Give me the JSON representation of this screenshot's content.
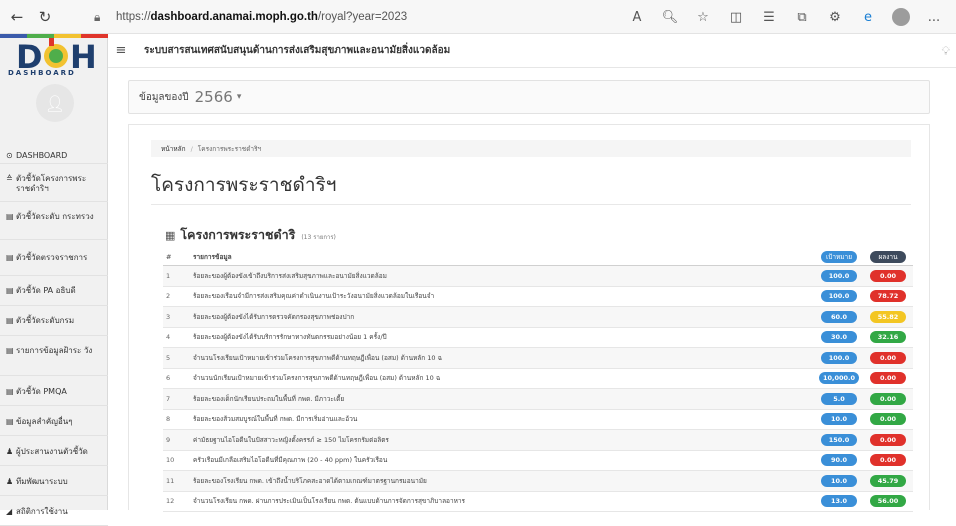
{
  "browser": {
    "back_icon": "back-arrow-icon",
    "reload_icon": "reload-icon",
    "url_scheme": "https://",
    "url_host": "dashboard.anamai.moph.go.th",
    "url_path": "/royal?year=2023",
    "more_label": "..."
  },
  "sidebar": {
    "logo_text": "DASHBOARD",
    "items": [
      {
        "icon": "⊙",
        "label": "DASHBOARD"
      },
      {
        "icon": "≙",
        "label": "ตัวชี้วัดโครงการพระ ราชดำริฯ"
      },
      {
        "icon": "▤",
        "label": "ตัวชี้วัดระดับ กระทรวง"
      },
      {
        "icon": "▤",
        "label": "ตัวชี้วัดตรวจราชการ"
      },
      {
        "icon": "▤",
        "label": "ตัวชี้วัด PA อธิบดี"
      },
      {
        "icon": "▤",
        "label": "ตัวชี้วัดระดับกรม"
      },
      {
        "icon": "▤",
        "label": "รายการข้อมูลฝ้าระ วัง"
      },
      {
        "icon": "▤",
        "label": "ตัวชี้วัด PMQA"
      },
      {
        "icon": "▤",
        "label": "ข้อมูลสำคัญอื่นๆ"
      },
      {
        "icon": "♟",
        "label": "ผู้ประสานงานตัวชี้วัด"
      },
      {
        "icon": "♟",
        "label": "ทีมพัฒนาระบบ"
      },
      {
        "icon": "◢",
        "label": "สถิติการใช้งาน"
      }
    ]
  },
  "topbar": {
    "title": "ระบบสารสนเทศสนับสนุนด้านการส่งเสริมสุขภาพและอนามัยสิ่งแวดล้อม"
  },
  "year_selector": {
    "label": "ข้อมูลของปี",
    "value": "2566"
  },
  "breadcrumb": {
    "home": "หน้าหลัก",
    "separator": "/",
    "current": "โครงการพระราชดำริฯ"
  },
  "page": {
    "title": "โครงการพระราชดำริฯ",
    "section_title": "โครงการพระราชดำริ",
    "section_count": "(13 รายการ)"
  },
  "table": {
    "headers": {
      "no": "#",
      "name": "รายการข้อมูล",
      "target": "เป้าหมาย",
      "result": "ผลงาน"
    },
    "rows": [
      {
        "no": "1",
        "name": "ร้อยละของผู้ต้องขังเข้าถึงบริการส่งเสริมสุขภาพและอนามัยสิ่งแวดล้อม",
        "target": "100.0",
        "result": "0.00",
        "status": "red"
      },
      {
        "no": "2",
        "name": "ร้อยละของเรือนจำมีการส่งเสริมคุณค่าดำเนินงานเป้าระวังอนามัยสิ่งแวดล้อมในเรือนจำ",
        "target": "100.0",
        "result": "78.72",
        "status": "red"
      },
      {
        "no": "3",
        "name": "ร้อยละของผู้ต้องขังได้รับการตรวจคัดกรองสุขภาพช่องปาก",
        "target": "60.0",
        "result": "55.82",
        "status": "yellow"
      },
      {
        "no": "4",
        "name": "ร้อยละของผู้ต้องขังได้รับบริการรักษาทางทันตกรรมอย่างน้อย 1 ครั้ง/ปี",
        "target": "30.0",
        "result": "32.16",
        "status": "green"
      },
      {
        "no": "5",
        "name": "จำนวนโรงเรียนเป้าหมายเข้าร่วมโครงการสุขภาพดีด้านทฤษฎีเพื่อน (อสม) ด้านหลัก 10 ฉ",
        "target": "100.0",
        "result": "0.00",
        "status": "red"
      },
      {
        "no": "6",
        "name": "จำนวนนักเรียนเป้าหมายเข้าร่วมโครงการสุขภาพดีด้านทฤษฎีเพื่อน (อสม) ด้านหลัก 10 ฉ",
        "target": "10,000.0",
        "result": "0.00",
        "status": "red"
      },
      {
        "no": "7",
        "name": "ร้อยละของเด็กนักเรียนประถมในพื้นที่ กพด. มีภาวะเตี้ย",
        "target": "5.0",
        "result": "0.00",
        "status": "green"
      },
      {
        "no": "8",
        "name": "ร้อยละของส้วมสมบูรณ์ในพื้นที่ กพด. มีการเริ่มอ่านและอ้วน",
        "target": "10.0",
        "result": "0.00",
        "status": "green"
      },
      {
        "no": "9",
        "name": "ค่ามัธยฐานไอโอดีนในปัสสาวะหญิงตั้งครรภ์ ≥ 150 ไมโครกรัมต่อลิตร",
        "target": "150.0",
        "result": "0.00",
        "status": "red"
      },
      {
        "no": "10",
        "name": "ครัวเรือนมีเกลือเสริมไอโอดีนที่มีคุณภาพ (20 - 40 ppm) ในครัวเรือน",
        "target": "90.0",
        "result": "0.00",
        "status": "red"
      },
      {
        "no": "11",
        "name": "ร้อยละของโรงเรียน กพด. เข้าถึงน้ำบริโภคสะอาดได้ตามเกณฑ์มาตรฐานกรมอนามัย",
        "target": "10.0",
        "result": "45.79",
        "status": "green"
      },
      {
        "no": "12",
        "name": "จำนวนโรงเรียน กพด. ผ่านการประเมินเป็นโรงเรียน กพด. ต้นแบบด้านการจัดการสุขาภิบาลอาหาร",
        "target": "13.0",
        "result": "56.00",
        "status": "green"
      }
    ]
  },
  "colors": {
    "target_pill": "#3a8fd8",
    "result_head_pill": "#3d4a5c",
    "red": "#e0312b",
    "green": "#32a845",
    "yellow": "#f3c623"
  }
}
